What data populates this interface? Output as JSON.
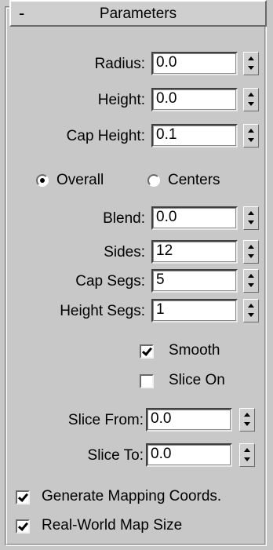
{
  "rollout": {
    "collapse_symbol": "-",
    "title": "Parameters"
  },
  "params": {
    "radius": {
      "label": "Radius:",
      "value": "0.0"
    },
    "height": {
      "label": "Height:",
      "value": "0.0"
    },
    "cap_height": {
      "label": "Cap Height:",
      "value": "0.1"
    }
  },
  "mode": {
    "overall_label": "Overall",
    "centers_label": "Centers",
    "selected": "Overall"
  },
  "segments": {
    "blend": {
      "label": "Blend:",
      "value": "0.0"
    },
    "sides": {
      "label": "Sides:",
      "value": "12"
    },
    "cap_segs": {
      "label": "Cap Segs:",
      "value": "5"
    },
    "height_segs": {
      "label": "Height Segs:",
      "value": "1"
    }
  },
  "options": {
    "smooth": {
      "label": "Smooth",
      "checked": true
    },
    "slice_on": {
      "label": "Slice On",
      "checked": false
    }
  },
  "slice": {
    "from": {
      "label": "Slice From:",
      "value": "0.0"
    },
    "to": {
      "label": "Slice To:",
      "value": "0.0"
    }
  },
  "mapping": {
    "generate_coords": {
      "label": "Generate Mapping Coords.",
      "checked": true
    },
    "real_world": {
      "label": "Real-World Map Size",
      "checked": true
    }
  }
}
